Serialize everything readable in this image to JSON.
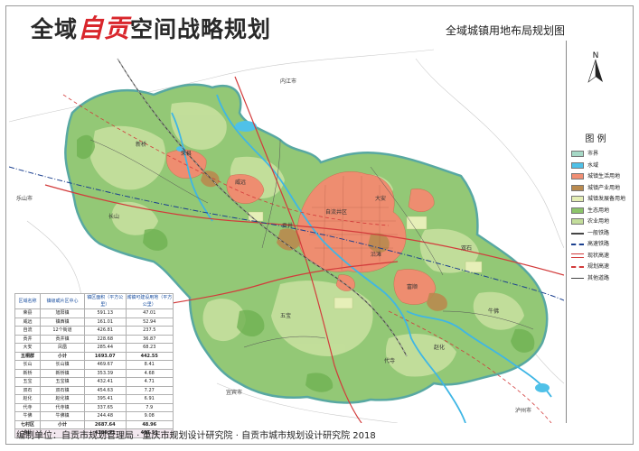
{
  "header": {
    "title_prefix": "全域",
    "title_highlight": "自贡",
    "title_suffix": "空间战略规划",
    "subtitle": "全域城镇用地布局规划图"
  },
  "legend": {
    "north_label": "N",
    "title": "图 例",
    "items": [
      {
        "label": "市界",
        "color": "#a6d8c6",
        "style": "fill"
      },
      {
        "label": "水域",
        "color": "#4fc1e8",
        "style": "fill"
      },
      {
        "label": "城镇生活用地",
        "color": "#f08f74",
        "style": "fill"
      },
      {
        "label": "城镇产业用地",
        "color": "#b98a4f",
        "style": "fill"
      },
      {
        "label": "城镇发展备用地",
        "color": "#e4eeb5",
        "style": "fill"
      },
      {
        "label": "生态用地",
        "color": "#8cc46a",
        "style": "fill"
      },
      {
        "label": "农业用地",
        "color": "#c3dd9b",
        "style": "fill"
      },
      {
        "label": "一般铁路",
        "color": "#444444",
        "style": "rail"
      },
      {
        "label": "高速铁路",
        "color": "#1a3f8f",
        "style": "dashdot"
      },
      {
        "label": "现状高速",
        "color": "#d23b3b",
        "style": "double"
      },
      {
        "label": "规划高速",
        "color": "#d23b3b",
        "style": "dash"
      },
      {
        "label": "其他道路",
        "color": "#444444",
        "style": "line"
      }
    ]
  },
  "table": {
    "headers": [
      "区域名称",
      "镇级或片区中心",
      "镇区面积（平方公里）",
      "城镇可建设用地（平方公里）"
    ],
    "groups": [
      {
        "name": "五桐群",
        "rows": [
          [
            "荣县",
            "旭阳镇",
            "591.13",
            "47.01"
          ],
          [
            "威远",
            "镇西镇",
            "161.01",
            "52.94"
          ],
          [
            "自流",
            "12个街道",
            "426.81",
            "237.5"
          ],
          [
            "贡井",
            "贡井镇",
            "228.68",
            "36.87"
          ],
          [
            "大安",
            "凤凰",
            "285.44",
            "68.23"
          ]
        ],
        "subtotal": [
          "小计",
          "",
          "1693.07",
          "442.55"
        ]
      },
      {
        "name": "七村区",
        "rows": [
          [
            "长山",
            "长山镇",
            "469.67",
            "8.41"
          ],
          [
            "新桥",
            "新桥镇",
            "353.39",
            "4.68"
          ],
          [
            "五宝",
            "五宝镇",
            "432.41",
            "4.71"
          ],
          [
            "双石",
            "双石镇",
            "454.63",
            "7.27"
          ],
          [
            "赵化",
            "赵化镇",
            "395.41",
            "6.91"
          ],
          [
            "代寺",
            "代寺镇",
            "337.65",
            "7.9"
          ],
          [
            "牛佛",
            "牛佛镇",
            "244.48",
            "9.08"
          ]
        ],
        "subtotal": [
          "小计",
          "",
          "2687.64",
          "48.96"
        ]
      }
    ],
    "total": [
      "合计",
      "",
      "4380.71",
      "491.51"
    ]
  },
  "map_labels": [
    {
      "text": "荣县"
    },
    {
      "text": "威远"
    },
    {
      "text": "贡井"
    },
    {
      "text": "自流井区"
    },
    {
      "text": "大安"
    },
    {
      "text": "沿滩"
    },
    {
      "text": "富顺"
    },
    {
      "text": "长山"
    },
    {
      "text": "五宝"
    },
    {
      "text": "赵化"
    },
    {
      "text": "牛佛"
    },
    {
      "text": "代寺"
    },
    {
      "text": "新桥"
    },
    {
      "text": "双石"
    },
    {
      "text": "宜宾市"
    },
    {
      "text": "内江市"
    },
    {
      "text": "乐山市"
    },
    {
      "text": "泸州市"
    }
  ],
  "footer": {
    "text": "编制单位：自贡市规划管理局 · 重庆市规划设计研究院 · 自贡市城市规划设计研究院 2018"
  }
}
